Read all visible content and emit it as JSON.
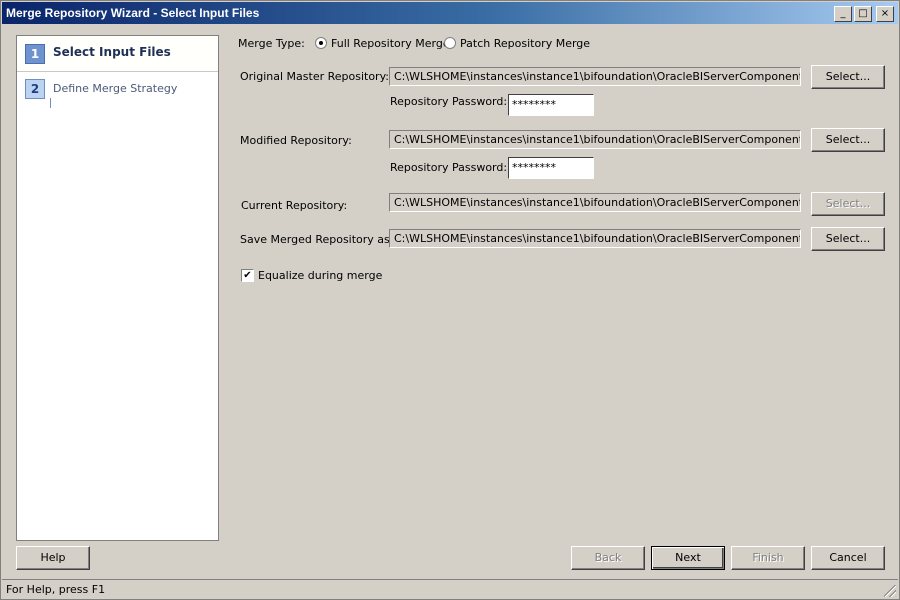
{
  "window": {
    "title": "Merge Repository Wizard - Select Input Files",
    "controls": {
      "minimize": "_",
      "maximize": "□",
      "close": "×"
    }
  },
  "steps": [
    {
      "number": "1",
      "label": "Select Input Files",
      "active": true
    },
    {
      "number": "2",
      "label": "Define Merge Strategy",
      "active": false
    }
  ],
  "merge_type": {
    "label": "Merge Type:",
    "options": [
      "Full Repository Merge",
      "Patch Repository Merge"
    ],
    "selected": "Full Repository Merge"
  },
  "original": {
    "label": "Original Master Repository:",
    "path": "C:\\WLSHOME\\instances\\instance1\\bifoundation\\OracleBIServerComponent\\coreappl",
    "select_label": "Select...",
    "password_label": "Repository Password:",
    "password": "********"
  },
  "modified": {
    "label": "Modified Repository:",
    "path": "C:\\WLSHOME\\instances\\instance1\\bifoundation\\OracleBIServerComponent\\coreappl",
    "select_label": "Select...",
    "password_label": "Repository Password:",
    "password": "********"
  },
  "current": {
    "label": "Current Repository:",
    "path": "C:\\WLSHOME\\instances\\instance1\\bifoundation\\OracleBIServerComponent\\coreappl",
    "select_label": "Select...",
    "select_disabled": true
  },
  "save_merged": {
    "label": "Save Merged Repository as:",
    "path": "C:\\WLSHOME\\instances\\instance1\\bifoundation\\OracleBIServerComponent\\coreappl",
    "select_label": "Select..."
  },
  "equalize": {
    "label": "Equalize during merge",
    "checked": true,
    "check_glyph": "✔"
  },
  "footer": {
    "help": "Help",
    "back": "Back",
    "next": "Next",
    "finish": "Finish",
    "cancel": "Cancel"
  },
  "status": {
    "text": "For Help, press F1"
  }
}
